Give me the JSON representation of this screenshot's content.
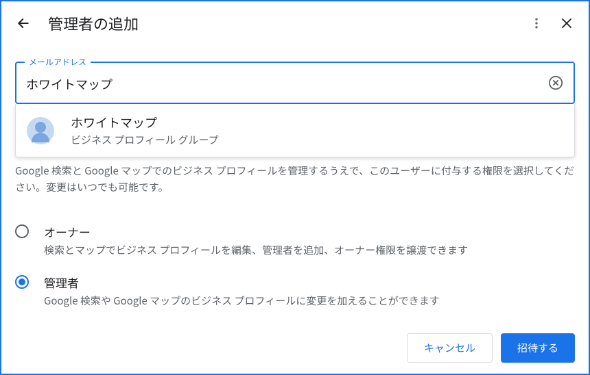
{
  "header": {
    "title": "管理者の追加"
  },
  "input": {
    "label": "メールアドレス",
    "value": "ホワイトマップ"
  },
  "suggestion": {
    "name": "ホワイトマップ",
    "subtitle": "ビジネス プロフィール グループ"
  },
  "description": "Google 検索と Google マップでのビジネス プロフィールを管理するうえで、このユーザーに付与する権限を選択してください。変更はいつでも可能です。",
  "roles": [
    {
      "title": "オーナー",
      "desc": "検索とマップでビジネス プロフィールを編集、管理者を追加、オーナー権限を譲渡できます",
      "selected": false
    },
    {
      "title": "管理者",
      "desc": "Google 検索や Google マップのビジネス プロフィールに変更を加えることができます",
      "selected": true
    }
  ],
  "footer": {
    "cancel": "キャンセル",
    "invite": "招待する"
  }
}
